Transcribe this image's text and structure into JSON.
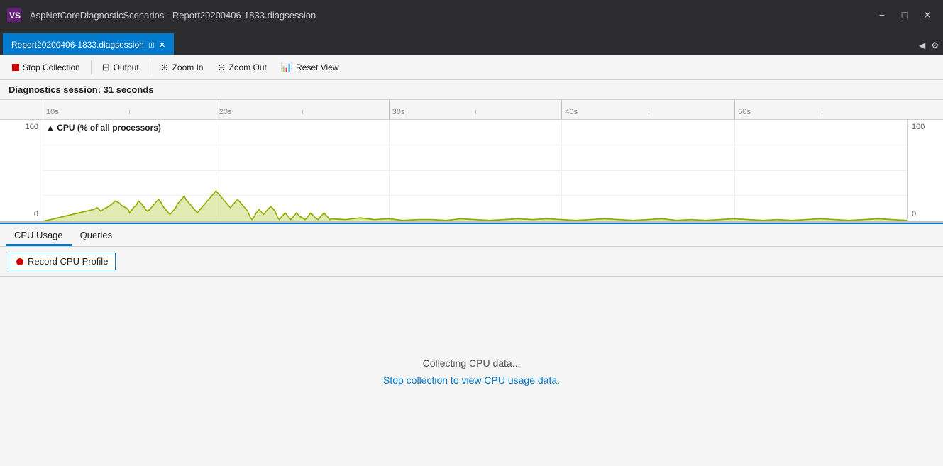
{
  "titleBar": {
    "logo": "VS",
    "title": "AspNetCoreDiagnosticScenarios - Report20200406-1833.diagsession",
    "minBtn": "−",
    "maxBtn": "□",
    "closeBtn": "✕"
  },
  "tabBar": {
    "tab": {
      "label": "Report20200406-1833.diagsession",
      "pinIcon": "⊞",
      "closeIcon": "✕"
    },
    "scrollLeft": "◀",
    "scrollRight": "▶",
    "settingsIcon": "⚙"
  },
  "toolbar": {
    "stopCollection": "Stop Collection",
    "output": "Output",
    "zoomIn": "Zoom In",
    "zoomOut": "Zoom Out",
    "resetView": "Reset View"
  },
  "diagnosticsHeader": {
    "text": "Diagnostics session: 31 seconds"
  },
  "ruler": {
    "ticks": [
      "10s",
      "20s",
      "30s",
      "40s",
      "50s"
    ]
  },
  "chart": {
    "title": "▲ CPU (% of all processors)",
    "yMax": "100",
    "yMin": "0",
    "yMaxRight": "100",
    "yMinRight": "0"
  },
  "bottomTabs": {
    "tabs": [
      {
        "label": "CPU Usage",
        "active": true
      },
      {
        "label": "Queries",
        "active": false
      }
    ]
  },
  "recordButton": {
    "label": "Record CPU Profile"
  },
  "centerMessage": {
    "collecting": "Collecting CPU data...",
    "link": "Stop collection to view CPU usage data."
  }
}
